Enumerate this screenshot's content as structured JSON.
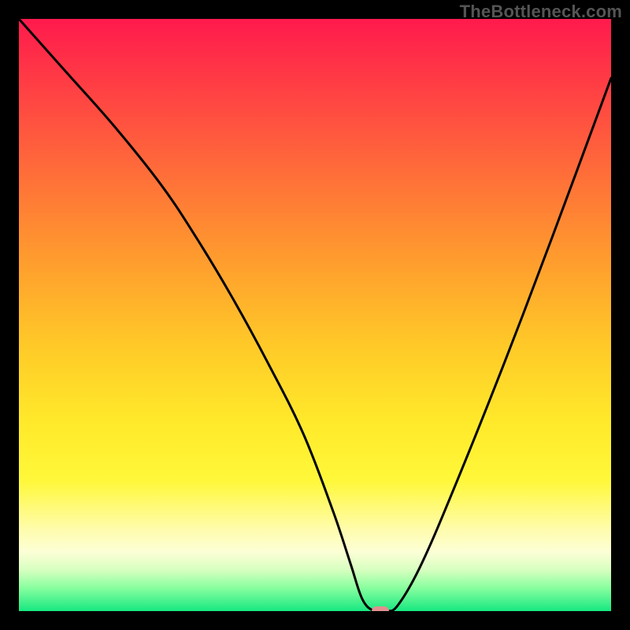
{
  "watermark": "TheBottleneck.com",
  "colors": {
    "frame": "#000000",
    "curve": "#000000",
    "marker": "#e38f8f",
    "gradient_top": "#ff1a4d",
    "gradient_bottom": "#17e880"
  },
  "chart_data": {
    "type": "line",
    "title": "",
    "xlabel": "",
    "ylabel": "",
    "xlim": [
      0,
      100
    ],
    "ylim": [
      0,
      100
    ],
    "grid": false,
    "legend": false,
    "annotations": [
      "TheBottleneck.com"
    ],
    "series": [
      {
        "name": "bottleneck-curve",
        "x": [
          0,
          8,
          16,
          24,
          30,
          36,
          42,
          48,
          53,
          56,
          58,
          60,
          62,
          64,
          68,
          74,
          82,
          90,
          100
        ],
        "y": [
          100,
          91,
          82,
          72,
          63,
          53,
          42,
          30,
          17,
          8,
          2,
          0,
          0,
          1,
          8,
          22,
          42,
          63,
          90
        ]
      }
    ],
    "marker": {
      "x": 61,
      "y": 0
    },
    "background_gradient": {
      "direction": "vertical",
      "stops": [
        {
          "pos": 0.0,
          "color": "#ff1a4d"
        },
        {
          "pos": 0.25,
          "color": "#ff6a3a"
        },
        {
          "pos": 0.55,
          "color": "#ffc928"
        },
        {
          "pos": 0.78,
          "color": "#fff83a"
        },
        {
          "pos": 0.9,
          "color": "#fcffd6"
        },
        {
          "pos": 1.0,
          "color": "#17e880"
        }
      ]
    }
  }
}
